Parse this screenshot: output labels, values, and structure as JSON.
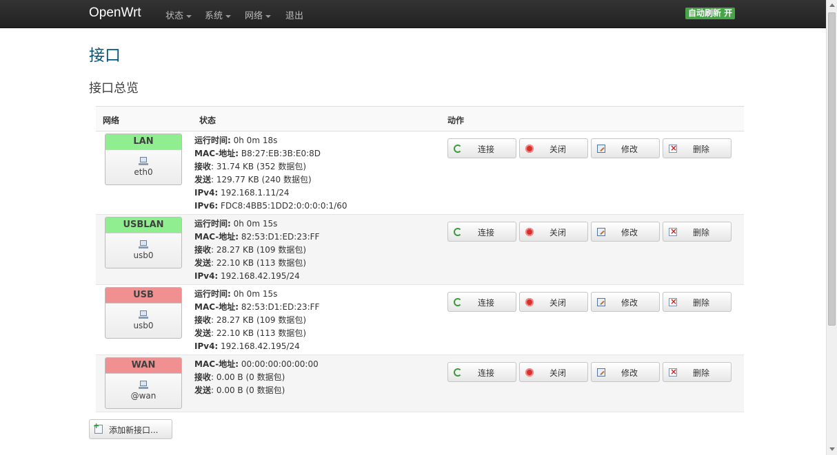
{
  "navbar": {
    "brand": "OpenWrt",
    "menu": [
      {
        "label": "状态",
        "has_caret": true
      },
      {
        "label": "系统",
        "has_caret": true
      },
      {
        "label": "网络",
        "has_caret": true
      },
      {
        "label": "退出",
        "has_caret": false
      }
    ],
    "auto_refresh": "自动刷新 开"
  },
  "page": {
    "title": "接口",
    "section_title": "接口总览"
  },
  "table": {
    "headers": {
      "network": "网络",
      "status": "状态",
      "actions": "动作"
    },
    "rows": [
      {
        "name": "LAN",
        "device": "eth0",
        "color": "#90ee90",
        "status": [
          {
            "k": "运行时间:",
            "v": " 0h 0m 18s"
          },
          {
            "k": "MAC-地址:",
            "v": " B8:27:EB:3B:E0:8D"
          },
          {
            "k": "接收",
            "v": ": 31.74 KB (352 数据包)"
          },
          {
            "k": "发送",
            "v": ": 129.77 KB (240 数据包)"
          },
          {
            "k": "IPv4:",
            "v": " 192.168.1.11/24"
          },
          {
            "k": "IPv6:",
            "v": " FDC8:4BB5:1DD2:0:0:0:0:1/60"
          }
        ]
      },
      {
        "name": "USBLAN",
        "device": "usb0",
        "color": "#90ee90",
        "status": [
          {
            "k": "运行时间:",
            "v": " 0h 0m 15s"
          },
          {
            "k": "MAC-地址:",
            "v": " 82:53:D1:ED:23:FF"
          },
          {
            "k": "接收",
            "v": ": 28.27 KB (109 数据包)"
          },
          {
            "k": "发送",
            "v": ": 22.10 KB (113 数据包)"
          },
          {
            "k": "IPv4:",
            "v": " 192.168.42.195/24"
          }
        ]
      },
      {
        "name": "USB",
        "device": "usb0",
        "color": "#f09090",
        "status": [
          {
            "k": "运行时间:",
            "v": " 0h 0m 15s"
          },
          {
            "k": "MAC-地址:",
            "v": " 82:53:D1:ED:23:FF"
          },
          {
            "k": "接收",
            "v": ": 28.27 KB (109 数据包)"
          },
          {
            "k": "发送",
            "v": ": 22.10 KB (113 数据包)"
          },
          {
            "k": "IPv4:",
            "v": " 192.168.42.195/24"
          }
        ]
      },
      {
        "name": "WAN",
        "device": "@wan",
        "color": "#f09090",
        "status": [
          {
            "k": "MAC-地址:",
            "v": " 00:00:00:00:00:00"
          },
          {
            "k": "接收",
            "v": ": 0.00 B (0 数据包)"
          },
          {
            "k": "发送",
            "v": ": 0.00 B (0 数据包)"
          }
        ]
      }
    ],
    "actions": [
      {
        "label": "连接",
        "icon": "reconnect-icon"
      },
      {
        "label": "关闭",
        "icon": "stop-icon"
      },
      {
        "label": "修改",
        "icon": "edit-icon"
      },
      {
        "label": "删除",
        "icon": "delete-icon"
      }
    ]
  },
  "add_button": "添加新接口..."
}
